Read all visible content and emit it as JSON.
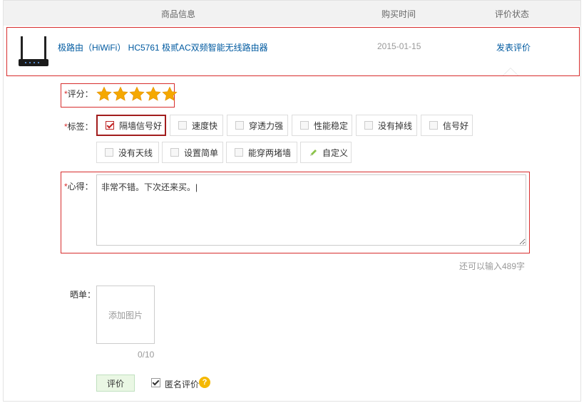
{
  "header": {
    "col_product": "商品信息",
    "col_time": "购买时间",
    "col_status": "评价状态"
  },
  "product": {
    "name": "极路由（HiWiFi） HC5761 极贰AC双频智能无线路由器",
    "date": "2015-01-15",
    "action": "发表评价"
  },
  "form": {
    "required_mark": "*",
    "rating_label": "评分：",
    "rating_value": 5,
    "rating_max": 5,
    "tags_label": "标签：",
    "tags": [
      {
        "label": "隔墙信号好",
        "checked": true
      },
      {
        "label": "速度快",
        "checked": false
      },
      {
        "label": "穿透力强",
        "checked": false
      },
      {
        "label": "性能稳定",
        "checked": false
      },
      {
        "label": "没有掉线",
        "checked": false
      },
      {
        "label": "信号好",
        "checked": false
      },
      {
        "label": "没有天线",
        "checked": false
      },
      {
        "label": "设置简单",
        "checked": false
      },
      {
        "label": "能穿两堵墙",
        "checked": false
      },
      {
        "label": "自定义",
        "checked": false
      }
    ],
    "comment_label": "心得：",
    "comment_value": "非常不错。下次还来买。|",
    "counter_text": "还可以输入489字",
    "photo_label": "晒单：",
    "upload_label": "添加图片",
    "upload_count": "0/10",
    "submit_label": "评价",
    "anonymous_label": "匿名评价",
    "anonymous_checked": true,
    "help_glyph": "?"
  },
  "colors": {
    "accent_red": "#d72d2d",
    "link_blue": "#005aa0",
    "star_gold": "#f5a800",
    "submit_green": "#eaf7e4"
  },
  "icons": {
    "product_thumb": "router-icon",
    "star": "star-icon",
    "custom_tag": "pencil-icon",
    "help": "question-icon"
  }
}
